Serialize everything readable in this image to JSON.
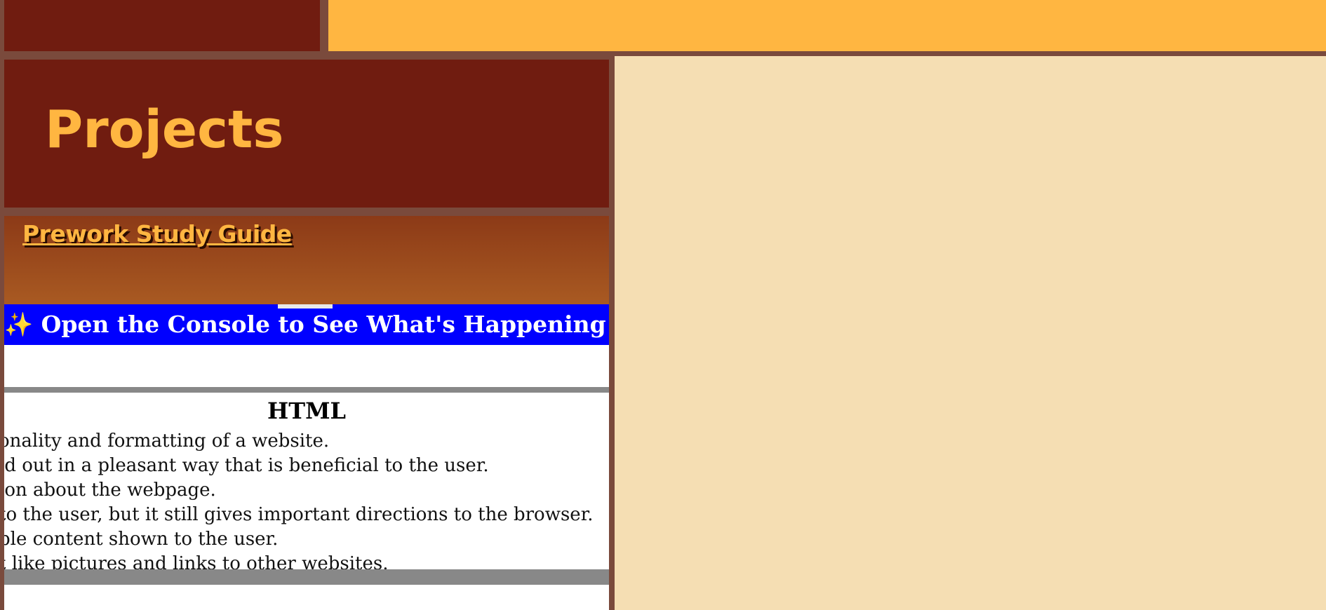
{
  "colors": {
    "frame": "#7a4a3c",
    "maroon": "#701c10",
    "gold": "#ffb641",
    "wheat": "#f5deb3",
    "banner_blue": "#0000ff"
  },
  "header": {
    "title": "Projects"
  },
  "project_card": {
    "link_label": "Prework Study Guide",
    "preview": {
      "banner_sparkle_left": "✨",
      "banner_text": "Open the Console to See What's Happening",
      "banner_sparkle_right": "✨",
      "section_title": "HTML",
      "lines": [
        "onality and formatting of a website.",
        "id out in a pleasant way that is beneficial to the user.",
        "ion about the webpage.",
        "to the user, but it still gives important directions to the browser.",
        "ble content shown to the user.",
        "t like pictures and links to other websites."
      ]
    }
  }
}
